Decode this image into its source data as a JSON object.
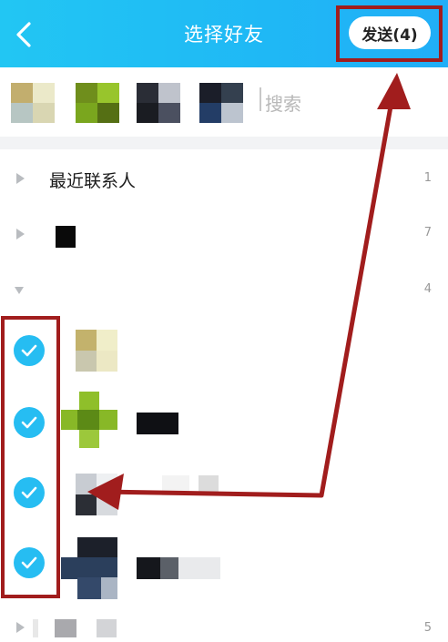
{
  "header": {
    "title": "选择好友",
    "send_label": "发送(4)"
  },
  "search": {
    "placeholder": "搜索"
  },
  "groups": [
    {
      "name": "最近联系人",
      "count": "1",
      "expanded": false
    },
    {
      "name": "",
      "count": "7",
      "expanded": false
    },
    {
      "name": "",
      "count": "4",
      "expanded": true
    },
    {
      "name": "",
      "count": "5",
      "expanded": false
    }
  ],
  "colors": {
    "header_start": "#22c6f3",
    "header_end": "#21aef7",
    "check": "#26bdf2",
    "annotation": "#a11d1d"
  }
}
